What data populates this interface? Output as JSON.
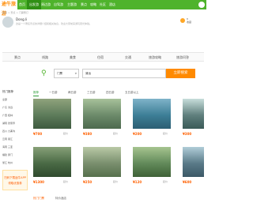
{
  "logo": "途牛旅游",
  "nav": [
    {
      "label": "首页",
      "active": false
    },
    {
      "label": "出发游",
      "active": true
    },
    {
      "label": "周边游",
      "active": false
    },
    {
      "label": "自驾游",
      "active": false
    },
    {
      "label": "主题游",
      "active": false
    },
    {
      "label": "景点",
      "active": false
    },
    {
      "label": "攻略",
      "active": false
    },
    {
      "label": "社区",
      "active": false
    },
    {
      "label": "酒店",
      "active": false
    }
  ],
  "breadcrumb": "首页 > 景点 > 门票预订",
  "spot": {
    "name": "Dong.li",
    "desc": "这是一个著名景点的详细介绍和相关信息，欢迎大家前来游玩观光体验。",
    "fav_count": "8",
    "fav_label": "收藏"
  },
  "tabs": [
    "景点",
    "线路",
    "美食",
    "住宿",
    "交通",
    "旅游攻略",
    "旅游问答"
  ],
  "search": {
    "select_value": "门票",
    "keyword": "清远",
    "button": "立即搜索"
  },
  "left": {
    "title": "热门推荐",
    "rows": [
      "全部",
      "广东 清远",
      "广西 桂林",
      "湖南 张家界",
      "四川 九寨沟",
      "云南 丽江",
      "海南 三亚",
      "福建 厦门",
      "浙江 杭州"
    ],
    "ad_lines": [
      "扫码下载途牛APP",
      "领取优惠券"
    ]
  },
  "filters": [
    {
      "label": "推荐",
      "active": true
    },
    {
      "label": "一日游",
      "active": false
    },
    {
      "label": "两日游",
      "active": false
    },
    {
      "label": "三日游",
      "active": false
    },
    {
      "label": "四日游",
      "active": false
    },
    {
      "label": "五日游以上",
      "active": false
    }
  ],
  "cards": [
    {
      "price": "¥700",
      "tag": "起价",
      "colors": [
        "#5d7b5a",
        "#8fa37c",
        "#3e5a3f"
      ]
    },
    {
      "price": "¥380",
      "tag": "起价",
      "colors": [
        "#6c8a6a",
        "#a7c19a",
        "#4d6a4e"
      ]
    },
    {
      "price": "¥200",
      "tag": "起价",
      "colors": [
        "#3d7e96",
        "#7fb3c9",
        "#2c5e73"
      ]
    },
    {
      "price": "¥300",
      "tag": "起价",
      "colors": [
        "#5f7f7d",
        "#c8dedb",
        "#3a5a57"
      ]
    },
    {
      "price": "¥1300",
      "tag": "起价",
      "colors": [
        "#4a6a45",
        "#87a078",
        "#2f4a2e"
      ]
    },
    {
      "price": "¥250",
      "tag": "起价",
      "colors": [
        "#7a8f6e",
        "#b9c9a6",
        "#56704c"
      ]
    },
    {
      "price": "¥120",
      "tag": "起价",
      "colors": [
        "#628a5a",
        "#a6c48f",
        "#3f6137"
      ]
    },
    {
      "price": "¥600",
      "tag": "起价",
      "colors": [
        "#5a7a88",
        "#b0cdd8",
        "#3b5866"
      ]
    }
  ],
  "bottom_tabs": [
    {
      "label": "热门门票",
      "active": true
    },
    {
      "label": "特价酒店",
      "active": false
    }
  ]
}
